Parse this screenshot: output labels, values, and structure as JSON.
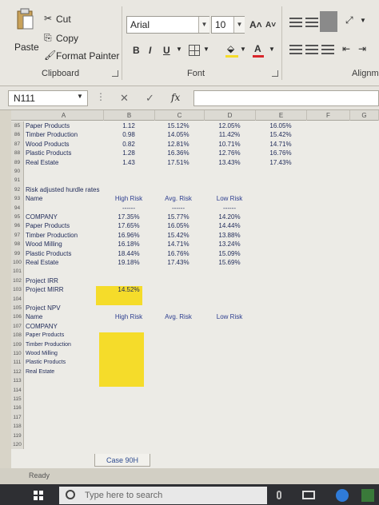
{
  "ribbon": {
    "clipboard": {
      "paste_label": "Paste",
      "cut_label": "Cut",
      "copy_label": "Copy",
      "format_painter_label": "Format Painter",
      "group_label": "Clipboard"
    },
    "font": {
      "font_name": "Arial",
      "font_size": "10",
      "grow_label": "A˄",
      "shrink_label": "A˅",
      "bold_label": "B",
      "italic_label": "I",
      "underline_label": "U",
      "font_color_label": "A",
      "group_label": "Font"
    },
    "alignment": {
      "group_label": "Alignm"
    }
  },
  "formula_bar": {
    "name_box": "N111",
    "cancel_icon": "✕",
    "enter_icon": "✓",
    "fx_label": "fx"
  },
  "columns": [
    "A",
    "B",
    "C",
    "D",
    "E",
    "F",
    "G"
  ],
  "rows": [
    {
      "n": "85",
      "a": "Paper Products",
      "b": "1.12",
      "c": "15.12%",
      "d": "12.05%",
      "e": "16.05%"
    },
    {
      "n": "86",
      "a": "Timber Production",
      "b": "0.98",
      "c": "14.05%",
      "d": "11.42%",
      "e": "15.42%"
    },
    {
      "n": "87",
      "a": "Wood Products",
      "b": "0.82",
      "c": "12.81%",
      "d": "10.71%",
      "e": "14.71%"
    },
    {
      "n": "88",
      "a": "Plastic Products",
      "b": "1.28",
      "c": "16.36%",
      "d": "12.76%",
      "e": "16.76%"
    },
    {
      "n": "89",
      "a": "Real Estate",
      "b": "1.43",
      "c": "17.51%",
      "d": "13.43%",
      "e": "17.43%"
    },
    {
      "n": "90",
      "a": "",
      "b": "",
      "c": "",
      "d": "",
      "e": ""
    },
    {
      "n": "91",
      "a": "",
      "b": "",
      "c": "",
      "d": "",
      "e": ""
    },
    {
      "n": "92",
      "a": "Risk adjusted hurdle rates",
      "b": "",
      "c": "",
      "d": "",
      "e": ""
    },
    {
      "n": "93",
      "a": "Name",
      "b": "High Risk",
      "c": "Avg. Risk",
      "d": "Low Risk",
      "e": "",
      "hdr": true
    },
    {
      "n": "94",
      "a": "",
      "b": "------",
      "c": "------",
      "d": "------",
      "e": ""
    },
    {
      "n": "95",
      "a": "COMPANY",
      "b": "17.35%",
      "c": "15.77%",
      "d": "14.20%",
      "e": ""
    },
    {
      "n": "96",
      "a": "Paper Products",
      "b": "17.65%",
      "c": "16.05%",
      "d": "14.44%",
      "e": ""
    },
    {
      "n": "97",
      "a": "Timber Production",
      "b": "16.96%",
      "c": "15.42%",
      "d": "13.88%",
      "e": ""
    },
    {
      "n": "98",
      "a": "Wood Milling",
      "b": "16.18%",
      "c": "14.71%",
      "d": "13.24%",
      "e": ""
    },
    {
      "n": "99",
      "a": "Plastic Products",
      "b": "18.44%",
      "c": "16.76%",
      "d": "15.09%",
      "e": ""
    },
    {
      "n": "100",
      "a": "Real Estate",
      "b": "19.18%",
      "c": "17.43%",
      "d": "15.69%",
      "e": ""
    },
    {
      "n": "101",
      "a": "",
      "b": "",
      "c": "",
      "d": "",
      "e": ""
    },
    {
      "n": "102",
      "a": "Project IRR",
      "b": "",
      "c": "",
      "d": "",
      "e": ""
    },
    {
      "n": "103",
      "a": "Project MIRR",
      "b": "14.52%",
      "c": "",
      "d": "",
      "e": ""
    },
    {
      "n": "104",
      "a": "",
      "b": "",
      "c": "",
      "d": "",
      "e": ""
    },
    {
      "n": "105",
      "a": "Project NPV",
      "b": "",
      "c": "",
      "d": "",
      "e": ""
    },
    {
      "n": "106",
      "a": "Name",
      "b": "High Risk",
      "c": "Avg. Risk",
      "d": "Low Risk",
      "e": "",
      "hdr": true
    },
    {
      "n": "107",
      "a": "COMPANY",
      "b": "",
      "c": "",
      "d": "",
      "e": ""
    },
    {
      "n": "108",
      "a": "Paper Products",
      "b": "",
      "c": "",
      "d": "",
      "e": "",
      "sm": true
    },
    {
      "n": "109",
      "a": "Timber Production",
      "b": "",
      "c": "",
      "d": "",
      "e": "",
      "sm": true
    },
    {
      "n": "110",
      "a": "Wood Milling",
      "b": "",
      "c": "",
      "d": "",
      "e": "",
      "sm": true
    },
    {
      "n": "111",
      "a": "Plastic Products",
      "b": "",
      "c": "",
      "d": "",
      "e": "",
      "sm": true
    },
    {
      "n": "112",
      "a": "Real Estate",
      "b": "",
      "c": "",
      "d": "",
      "e": "",
      "sm": true
    },
    {
      "n": "113",
      "a": "",
      "b": "",
      "c": "",
      "d": "",
      "e": ""
    },
    {
      "n": "114",
      "a": "",
      "b": "",
      "c": "",
      "d": "",
      "e": ""
    },
    {
      "n": "115",
      "a": "",
      "b": "",
      "c": "",
      "d": "",
      "e": ""
    },
    {
      "n": "116",
      "a": "",
      "b": "",
      "c": "",
      "d": "",
      "e": ""
    },
    {
      "n": "117",
      "a": "",
      "b": "",
      "c": "",
      "d": "",
      "e": ""
    },
    {
      "n": "118",
      "a": "",
      "b": "",
      "c": "",
      "d": "",
      "e": ""
    },
    {
      "n": "119",
      "a": "",
      "b": "",
      "c": "",
      "d": "",
      "e": ""
    },
    {
      "n": "120",
      "a": "",
      "b": "",
      "c": "",
      "d": "",
      "e": ""
    }
  ],
  "sheet_tab": "Case 90H",
  "status": "Ready",
  "taskbar": {
    "search_placeholder": "Type here to search"
  },
  "colors": {
    "highlight": "#f5dc2a",
    "cell_text": "#1f2a58"
  }
}
